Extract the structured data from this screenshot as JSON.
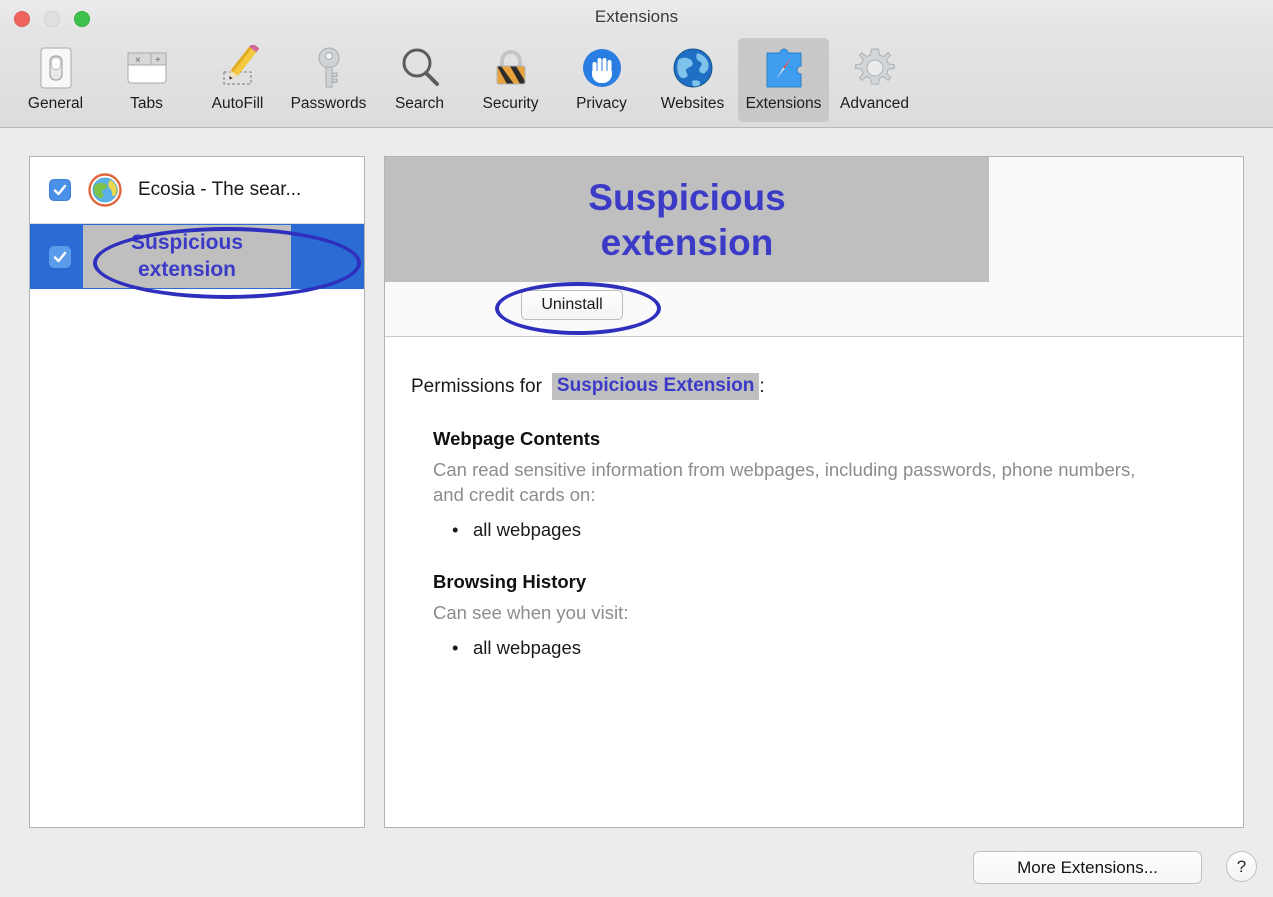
{
  "window": {
    "title": "Extensions",
    "traffic_lights": [
      "close-button",
      "minimize-button",
      "zoom-button"
    ]
  },
  "toolbar": {
    "items": [
      {
        "label": "General",
        "icon": "switch-icon",
        "selected": false
      },
      {
        "label": "Tabs",
        "icon": "tabs-icon",
        "selected": false
      },
      {
        "label": "AutoFill",
        "icon": "pencil-icon",
        "selected": false
      },
      {
        "label": "Passwords",
        "icon": "key-icon",
        "selected": false
      },
      {
        "label": "Search",
        "icon": "magnifier-icon",
        "selected": false
      },
      {
        "label": "Security",
        "icon": "padlock-icon",
        "selected": false
      },
      {
        "label": "Privacy",
        "icon": "hand-icon",
        "selected": false
      },
      {
        "label": "Websites",
        "icon": "globe-icon",
        "selected": false
      },
      {
        "label": "Extensions",
        "icon": "puzzle-compass-icon",
        "selected": true
      },
      {
        "label": "Advanced",
        "icon": "gear-icon",
        "selected": false
      }
    ]
  },
  "extension_list": {
    "rows": [
      {
        "name": "Ecosia - The sear...",
        "checked": true,
        "selected": false,
        "icon": "ecosia-globe-icon",
        "styled_box": false
      },
      {
        "name": "Suspicious extension",
        "checked": true,
        "selected": true,
        "icon": "none",
        "styled_box": true
      }
    ]
  },
  "detail": {
    "banner_title": "Suspicious extension",
    "uninstall_label": "Uninstall",
    "permissions_prefix": "Permissions for",
    "permissions_highlight": "Suspicious Extension",
    "permissions_suffix": ":",
    "sections": [
      {
        "title": "Webpage Contents",
        "description": "Can read sensitive information from webpages, including passwords, phone numbers, and credit cards on:",
        "items": [
          "all webpages"
        ]
      },
      {
        "title": "Browsing History",
        "description": "Can see when you visit:",
        "items": [
          "all webpages"
        ]
      }
    ]
  },
  "footer": {
    "more_extensions_label": "More Extensions...",
    "help_label": "?"
  },
  "annotations": {
    "sidebar_circle": "highlight-suspicious-extension-row",
    "uninstall_circle": "highlight-uninstall-button"
  },
  "colors": {
    "accent_blue": "#3b3bc8",
    "selection_blue": "#2a6bd4",
    "annotation_blue": "#2f2fbe",
    "highlight_gray": "#bfbfbf"
  }
}
